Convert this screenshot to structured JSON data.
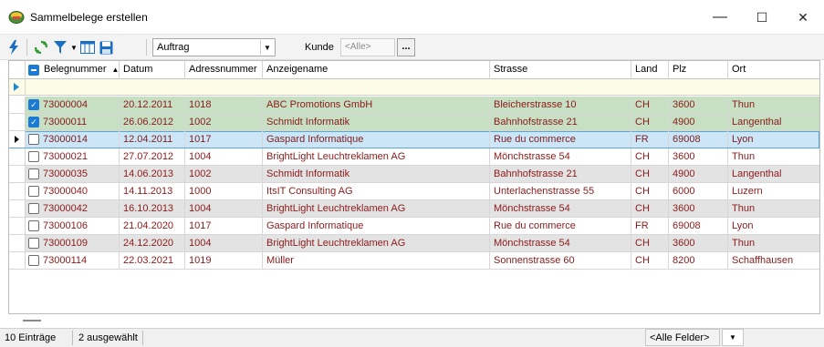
{
  "window": {
    "title": "Sammelbelege erstellen",
    "minimize": "—",
    "maximize": "☐",
    "close": "✕"
  },
  "toolbar": {
    "doc_type": "Auftrag",
    "kunde_label": "Kunde",
    "kunde_value": "<Alle>",
    "browse_label": "..."
  },
  "columns": [
    "Belegnummer",
    "Datum",
    "Adressnummer",
    "Anzeigename",
    "Strasse",
    "Land",
    "Plz",
    "Ort"
  ],
  "colors": {
    "selected_row_bg": "#c7dfc3",
    "current_row_bg": "#cde6f7",
    "alt_row_bg": "#e3e3e3",
    "plain_row_bg": "#ffffff",
    "data_text_red": "#8b1a1a",
    "current_text": "#7b1e1e"
  },
  "rows": [
    {
      "checked": true,
      "state": "selected",
      "cells": [
        "73000004",
        "20.12.2011",
        "1018",
        "ABC Promotions GmbH",
        "Bleicherstrasse 10",
        "CH",
        "3600",
        "Thun"
      ]
    },
    {
      "checked": true,
      "state": "selected",
      "cells": [
        "73000011",
        "26.06.2012",
        "1002",
        "Schmidt Informatik",
        "Bahnhofstrasse 21",
        "CH",
        "4900",
        "Langenthal"
      ]
    },
    {
      "checked": false,
      "state": "current",
      "cells": [
        "73000014",
        "12.04.2011",
        "1017",
        "Gaspard Informatique",
        "Rue du commerce",
        "FR",
        "69008",
        "Lyon"
      ]
    },
    {
      "checked": false,
      "state": "plain",
      "cells": [
        "73000021",
        "27.07.2012",
        "1004",
        "BrightLight Leuchtreklamen AG",
        "Mönchstrasse 54",
        "CH",
        "3600",
        "Thun"
      ]
    },
    {
      "checked": false,
      "state": "alt",
      "cells": [
        "73000035",
        "14.06.2013",
        "1002",
        "Schmidt Informatik",
        "Bahnhofstrasse 21",
        "CH",
        "4900",
        "Langenthal"
      ]
    },
    {
      "checked": false,
      "state": "plain",
      "cells": [
        "73000040",
        "14.11.2013",
        "1000",
        "ItsIT Consulting AG",
        "Unterlachenstrasse 55",
        "CH",
        "6000",
        "Luzern"
      ]
    },
    {
      "checked": false,
      "state": "alt",
      "cells": [
        "73000042",
        "16.10.2013",
        "1004",
        "BrightLight Leuchtreklamen AG",
        "Mönchstrasse 54",
        "CH",
        "3600",
        "Thun"
      ]
    },
    {
      "checked": false,
      "state": "plain",
      "cells": [
        "73000106",
        "21.04.2020",
        "1017",
        "Gaspard Informatique",
        "Rue du commerce",
        "FR",
        "69008",
        "Lyon"
      ]
    },
    {
      "checked": false,
      "state": "alt",
      "cells": [
        "73000109",
        "24.12.2020",
        "1004",
        "BrightLight Leuchtreklamen AG",
        "Mönchstrasse 54",
        "CH",
        "3600",
        "Thun"
      ]
    },
    {
      "checked": false,
      "state": "plain",
      "cells": [
        "73000114",
        "22.03.2021",
        "1019",
        "Müller",
        "Sonnenstrasse 60",
        "CH",
        "8200",
        "Schaffhausen"
      ]
    }
  ],
  "status": {
    "count": "10 Einträge",
    "selected": "2 ausgewählt",
    "field_filter": "<Alle Felder>"
  }
}
